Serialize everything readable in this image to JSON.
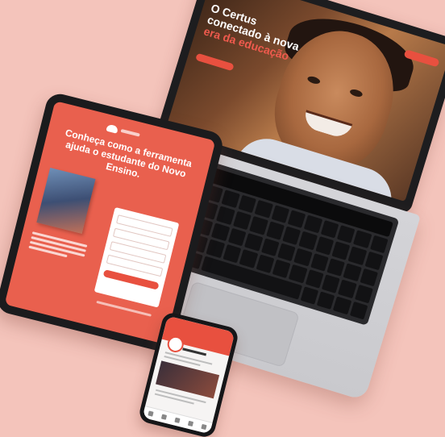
{
  "laptop_screen": {
    "hero_line1": "O Certus",
    "hero_line2": "conectado à nova",
    "hero_accent": "era da educação"
  },
  "tablet_screen": {
    "headline": "Conheça como a ferramenta ajuda o estudante do Novo Ensino."
  },
  "colors": {
    "background": "#f4c4bb",
    "brand": "#e8503f"
  }
}
